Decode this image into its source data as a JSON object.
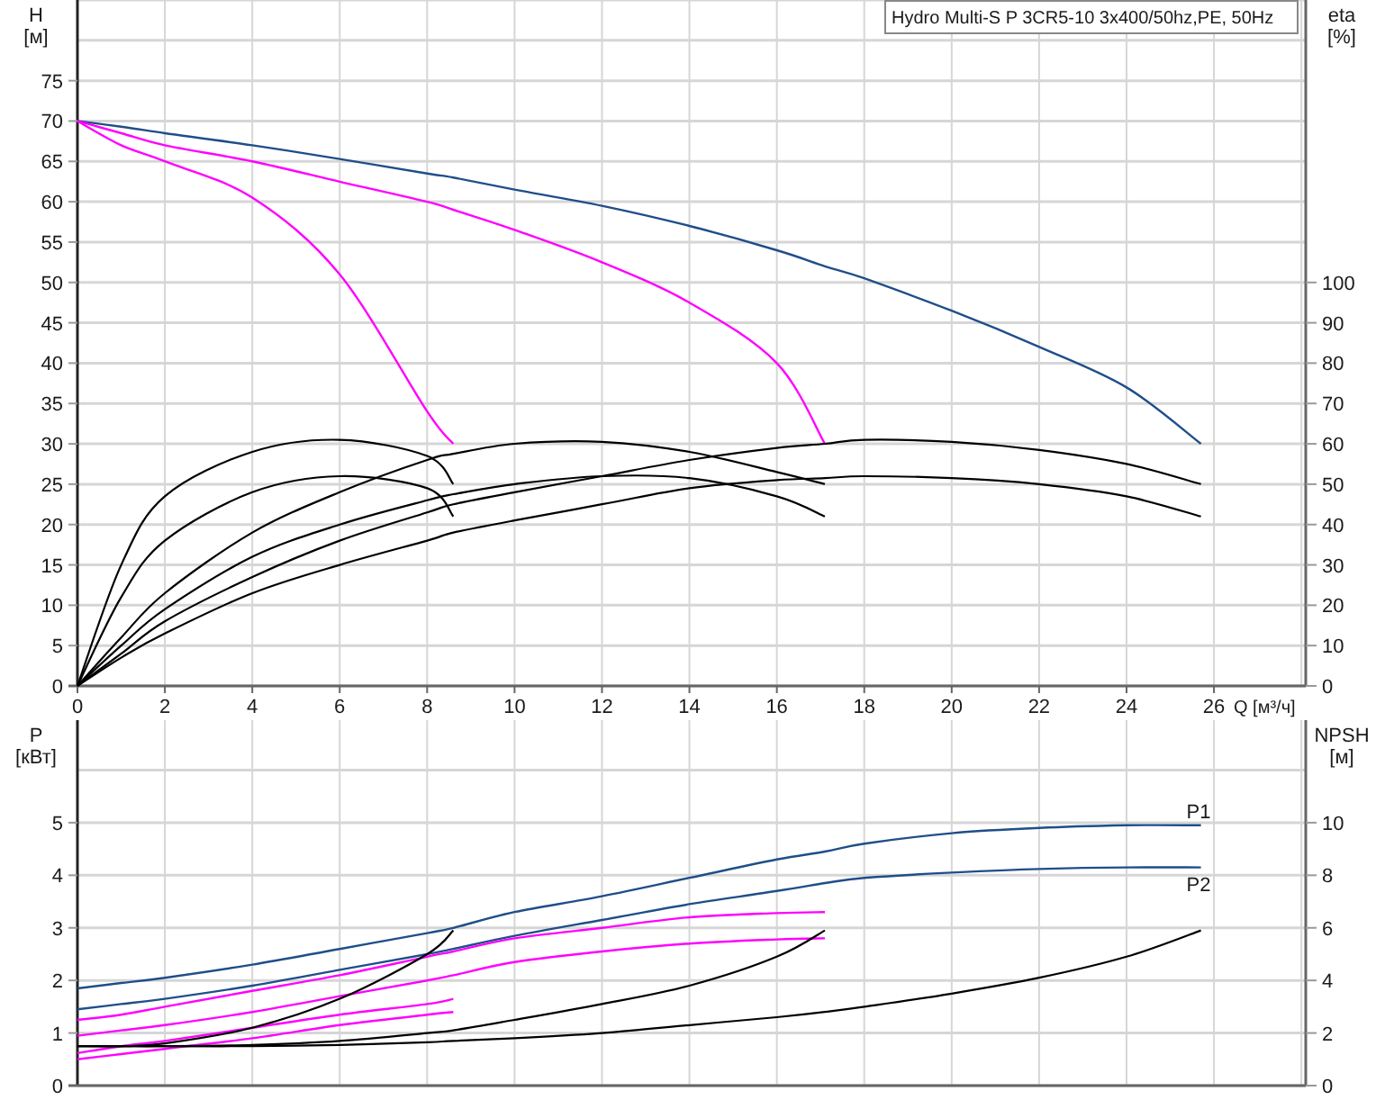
{
  "charts": [
    {
      "chart_data": {
        "type": "line",
        "grid": true,
        "title": "Hydro Multi-S P 3CR5-10 3x400/50hz,PE, 50Hz",
        "xlabel": "Q [м³/ч]",
        "ylabel": "H [м]",
        "y2label": "eta [%]",
        "x": [
          0,
          1,
          2,
          4,
          6,
          8,
          8.6,
          10,
          12,
          14,
          16,
          17.1,
          18,
          20,
          22,
          24,
          25.7
        ],
        "xlim": [
          0,
          28.1
        ],
        "ylim": [
          0,
          85
        ],
        "y2lim": [
          0,
          170
        ],
        "xticks": [
          0,
          2,
          4,
          6,
          8,
          10,
          12,
          14,
          16,
          18,
          20,
          22,
          24,
          26
        ],
        "yticks": [
          0,
          5,
          10,
          15,
          20,
          25,
          30,
          35,
          40,
          45,
          50,
          55,
          60,
          65,
          70,
          75
        ],
        "y2ticks": [
          0,
          10,
          20,
          30,
          40,
          50,
          60,
          70,
          80,
          90,
          100
        ],
        "series": [
          {
            "color": "#1f4e89",
            "values": [
              70,
              69.3,
              68.5,
              67,
              65.3,
              63.5,
              63,
              61.5,
              59.5,
              57,
              54,
              52,
              50.5,
              46.5,
              42,
              37,
              30
            ]
          },
          {
            "color": "#ff00ff",
            "values": [
              70,
              68.5,
              67,
              65,
              62.5,
              60,
              59,
              56.5,
              52.5,
              47.5,
              40,
              30,
              null,
              null,
              null,
              null,
              null
            ]
          },
          {
            "color": "#ff00ff",
            "values": [
              70,
              67,
              65,
              60.5,
              51,
              34,
              30,
              null,
              null,
              null,
              null,
              null,
              null,
              null,
              null,
              null,
              null
            ]
          },
          {
            "color": "#000000",
            "axis": "y2",
            "values": [
              0,
              30,
              47,
              58,
              61,
              57,
              50,
              null,
              null,
              null,
              null,
              null,
              null,
              null,
              null,
              null,
              null
            ]
          },
          {
            "color": "#000000",
            "axis": "y2",
            "values": [
              0,
              22,
              36,
              48,
              52,
              49,
              42,
              null,
              null,
              null,
              null,
              null,
              null,
              null,
              null,
              null,
              null
            ]
          },
          {
            "color": "#000000",
            "axis": "y2",
            "values": [
              0,
              12,
              23,
              38,
              48,
              56,
              57.5,
              60,
              60.5,
              58,
              53,
              50,
              null,
              null,
              null,
              null,
              null
            ]
          },
          {
            "color": "#000000",
            "axis": "y2",
            "values": [
              0,
              10,
              19,
              32,
              40,
              46,
              47.5,
              50,
              52,
              51.5,
              47,
              42,
              null,
              null,
              null,
              null,
              null
            ]
          },
          {
            "color": "#000000",
            "axis": "y2",
            "values": [
              0,
              8,
              16,
              27,
              36,
              43,
              45,
              48,
              52,
              56,
              59,
              60,
              61,
              60.5,
              58.5,
              55,
              50
            ]
          },
          {
            "color": "#000000",
            "axis": "y2",
            "values": [
              0,
              7,
              13,
              23,
              30,
              36,
              38,
              41,
              45,
              49,
              51,
              51.5,
              52,
              51.5,
              50,
              47,
              42
            ]
          }
        ]
      }
    },
    {
      "chart_data": {
        "type": "line",
        "grid": true,
        "ylabel": "P [кВт]",
        "y2label": "NPSH [м]",
        "x": [
          0,
          1,
          2,
          4,
          6,
          8,
          8.6,
          10,
          12,
          14,
          16,
          17.1,
          18,
          20,
          22,
          24,
          25.7
        ],
        "xlim": [
          0,
          28.1
        ],
        "ylim": [
          0,
          6.95
        ],
        "y2lim": [
          0,
          13.9
        ],
        "yticks": [
          0,
          1,
          2,
          3,
          4,
          5
        ],
        "y2ticks": [
          0,
          2,
          4,
          6,
          8,
          10
        ],
        "series": [
          {
            "name": "P1",
            "color": "#1f4e89",
            "values": [
              1.85,
              1.95,
              2.05,
              2.3,
              2.6,
              2.9,
              3.0,
              3.3,
              3.6,
              3.95,
              4.3,
              4.45,
              4.6,
              4.8,
              4.9,
              4.95,
              4.95
            ]
          },
          {
            "name": "P2",
            "color": "#1f4e89",
            "values": [
              1.45,
              1.55,
              1.65,
              1.9,
              2.2,
              2.5,
              2.6,
              2.85,
              3.15,
              3.45,
              3.7,
              3.85,
              3.95,
              4.05,
              4.12,
              4.15,
              4.15
            ]
          },
          {
            "color": "#ff00ff",
            "values": [
              1.25,
              1.35,
              1.5,
              1.8,
              2.1,
              2.45,
              2.55,
              2.8,
              3.0,
              3.2,
              3.28,
              3.3,
              null,
              null,
              null,
              null,
              null
            ]
          },
          {
            "color": "#ff00ff",
            "values": [
              0.95,
              1.05,
              1.15,
              1.4,
              1.7,
              2.0,
              2.1,
              2.35,
              2.55,
              2.7,
              2.78,
              2.8,
              null,
              null,
              null,
              null,
              null
            ]
          },
          {
            "color": "#ff00ff",
            "values": [
              0.62,
              0.75,
              0.85,
              1.1,
              1.35,
              1.55,
              1.65,
              null,
              null,
              null,
              null,
              null,
              null,
              null,
              null,
              null,
              null
            ]
          },
          {
            "color": "#ff00ff",
            "values": [
              0.5,
              0.6,
              0.7,
              0.9,
              1.15,
              1.35,
              1.4,
              null,
              null,
              null,
              null,
              null,
              null,
              null,
              null,
              null,
              null
            ]
          },
          {
            "color": "#000000",
            "axis": "y2",
            "values": [
              1.5,
              1.5,
              1.6,
              2.2,
              3.3,
              5.0,
              5.9,
              null,
              null,
              null,
              null,
              null,
              null,
              null,
              null,
              null,
              null
            ]
          },
          {
            "color": "#000000",
            "axis": "y2",
            "values": [
              1.5,
              1.5,
              1.5,
              1.55,
              1.7,
              2.0,
              2.1,
              2.5,
              3.1,
              3.8,
              4.9,
              5.9,
              null,
              null,
              null,
              null,
              null
            ]
          },
          {
            "color": "#000000",
            "axis": "y2",
            "values": [
              1.5,
              1.5,
              1.5,
              1.5,
              1.55,
              1.65,
              1.7,
              1.8,
              2.0,
              2.3,
              2.6,
              2.8,
              3.0,
              3.5,
              4.1,
              4.9,
              5.9
            ]
          }
        ]
      }
    }
  ]
}
